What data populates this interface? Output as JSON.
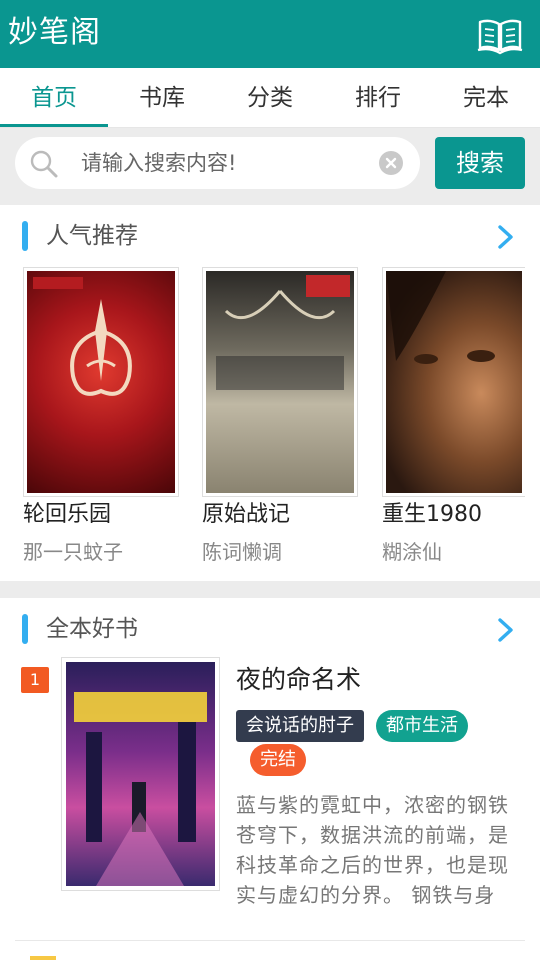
{
  "header": {
    "title": "妙笔阁",
    "book_icon": "open-book-icon"
  },
  "tabs": [
    {
      "label": "首页",
      "active": true
    },
    {
      "label": "书库",
      "active": false
    },
    {
      "label": "分类",
      "active": false
    },
    {
      "label": "排行",
      "active": false
    },
    {
      "label": "完本",
      "active": false
    }
  ],
  "search": {
    "placeholder": "请输入搜索内容!",
    "value": "",
    "button_label": "搜索"
  },
  "popular": {
    "title": "人气推荐",
    "books": [
      {
        "title": "轮回乐园",
        "author": "那一只蚊子",
        "cover_color": "#8e1418"
      },
      {
        "title": "原始战记",
        "author": "陈词懒调",
        "cover_color": "#6f6a5c"
      },
      {
        "title": "重生1980",
        "author": "糊涂仙",
        "cover_color": "#5a3a22"
      }
    ]
  },
  "full_books": {
    "title": "全本好书",
    "items": [
      {
        "rank": "1",
        "title": "夜的命名术",
        "author": "会说话的肘子",
        "genre": "都市生活",
        "status": "完结",
        "description": "蓝与紫的霓虹中，浓密的钢铁苍穹下，数据洪流的前端，是科技革命之后的世界，也是现实与虚幻的分界。 钢铁与身"
      }
    ]
  },
  "colors": {
    "primary": "#0a9690",
    "accent_bar": "#33aef0",
    "rank_badge": "#f25a22"
  }
}
